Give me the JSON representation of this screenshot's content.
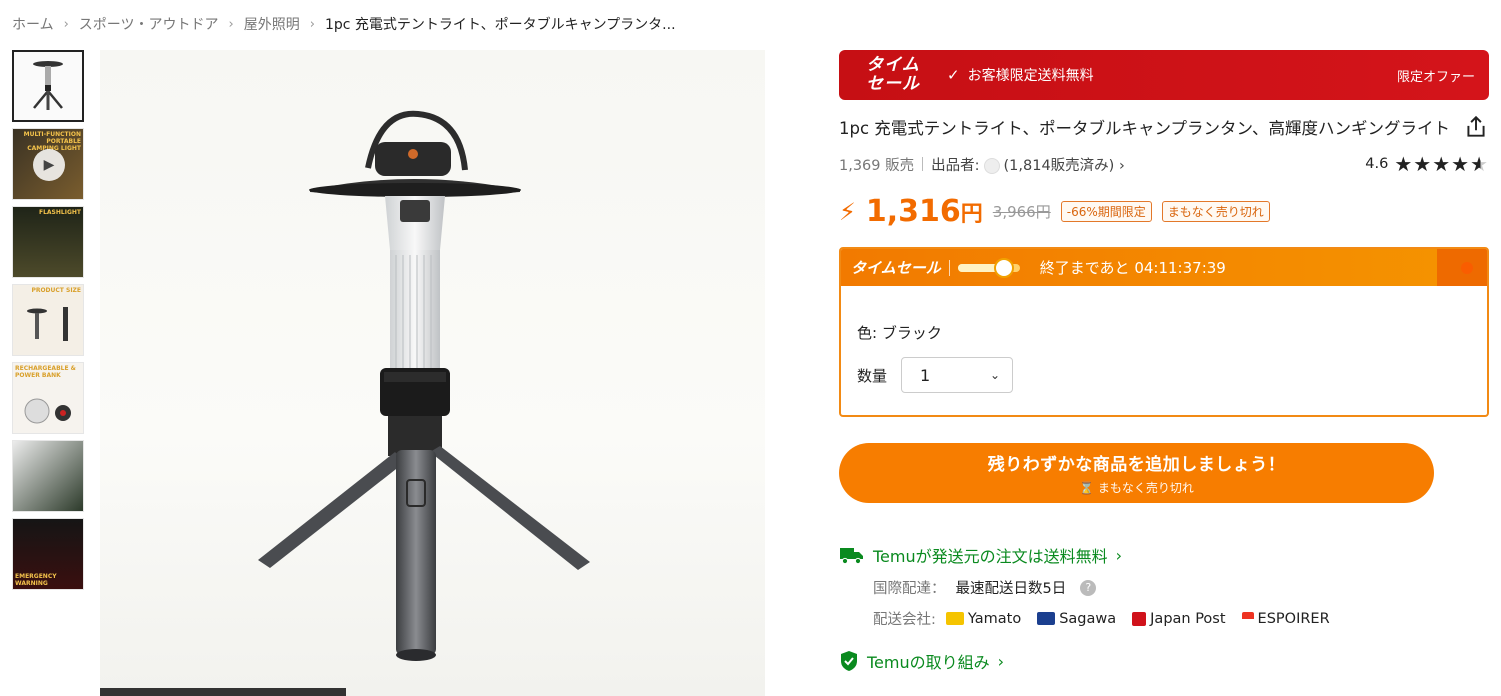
{
  "breadcrumb": {
    "items": [
      "ホーム",
      "スポーツ・アウトドア",
      "屋外照明"
    ],
    "current": "1pc 充電式テントライト、ポータブルキャンプランタ..."
  },
  "thumbnails": {
    "captions": [
      "",
      "MULTI-FUNCTION PORTABLE CAMPING LIGHT",
      "FLASHLIGHT",
      "PRODUCT SIZE",
      "RECHARGEABLE & POWER BANK",
      "",
      "EMERGENCY WARNING"
    ]
  },
  "sale_banner": {
    "logo_line1": "タイム",
    "logo_line2": "セール",
    "text": "お客様限定送料無料",
    "right_text": "限定オファー"
  },
  "product": {
    "title": "1pc 充電式テントライト、ポータブルキャンプランタン、高輝度ハンギングライト",
    "sold": "1,369 販売",
    "seller_label": "出品者:",
    "seller_sales": "(1,814販売済み)",
    "rating": "4.6",
    "price_value": "1,316",
    "price_unit": "円",
    "original_price": "3,966円",
    "discount_tag": "-66%期間限定",
    "stock_tag": "まもなく売り切れ"
  },
  "timesale": {
    "label": "タイムセール",
    "countdown": "終了まであと 04:11:37:39",
    "progress_fraction": 0.75
  },
  "options": {
    "color": "色: ブラック",
    "qty_label": "数量",
    "qty_value": "1"
  },
  "cta": {
    "main": "残りわずかな商品を追加しましょう！",
    "sub": "まもなく売り切れ"
  },
  "shipping": {
    "headline": "Temuが発送元の注文は送料無料",
    "intl_label": "国際配達：",
    "intl_value": "最速配送日数5日",
    "carrier_label": "配送会社:",
    "carriers": [
      "Yamato",
      "Sagawa",
      "Japan Post",
      "ESPOIRER"
    ]
  },
  "temu_commitment": "Temuの取り組み",
  "colors": {
    "accent_orange": "#f77d00",
    "sale_red": "#c60f14",
    "green": "#0a8a1f"
  }
}
